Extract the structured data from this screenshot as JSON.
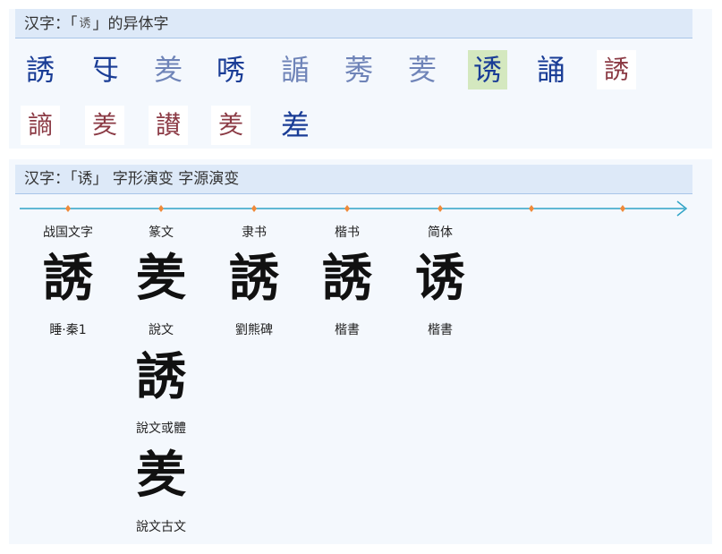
{
  "variants_panel": {
    "title_prefix": "汉字：「",
    "title_glyph": "诱",
    "title_suffix": "」的异体字",
    "glyphs": [
      {
        "char": "誘",
        "style": "normal"
      },
      {
        "char": "㸦",
        "style": "normal"
      },
      {
        "char": "羑",
        "style": "faded"
      },
      {
        "char": "唀",
        "style": "normal"
      },
      {
        "char": "䛻",
        "style": "faded"
      },
      {
        "char": "莠",
        "style": "faded"
      },
      {
        "char": "羐",
        "style": "faded"
      },
      {
        "char": "诱",
        "style": "selected"
      },
      {
        "char": "誦",
        "style": "normal"
      },
      {
        "char": "誘",
        "style": "img"
      },
      {
        "char": "謪",
        "style": "img"
      },
      {
        "char": "羑",
        "style": "img"
      },
      {
        "char": "讃",
        "style": "img"
      },
      {
        "char": "羑",
        "style": "img"
      },
      {
        "char": "差",
        "style": "normal"
      }
    ]
  },
  "evolution_panel": {
    "title_prefix": "汉字：「",
    "title_glyph": "诱",
    "title_suffix": "」 字形演变 字源演变",
    "eras": [
      "战国文字",
      "篆文",
      "隶书",
      "楷书",
      "简体"
    ],
    "columns": [
      {
        "items": [
          {
            "glyph": "誘",
            "source": "睡·秦1"
          }
        ]
      },
      {
        "items": [
          {
            "glyph": "羑",
            "source": "說文"
          },
          {
            "glyph": "誘",
            "source": "說文或體"
          },
          {
            "glyph": "羑",
            "source": "說文古文"
          }
        ]
      },
      {
        "items": [
          {
            "glyph": "誘",
            "source": "劉熊碑"
          }
        ]
      },
      {
        "items": [
          {
            "glyph": "誘",
            "source": "楷書"
          }
        ]
      },
      {
        "items": [
          {
            "glyph": "诱",
            "source": "楷書"
          }
        ]
      }
    ],
    "timeline_color": "#2fa3c6",
    "marker_color": "#f08a3a"
  }
}
